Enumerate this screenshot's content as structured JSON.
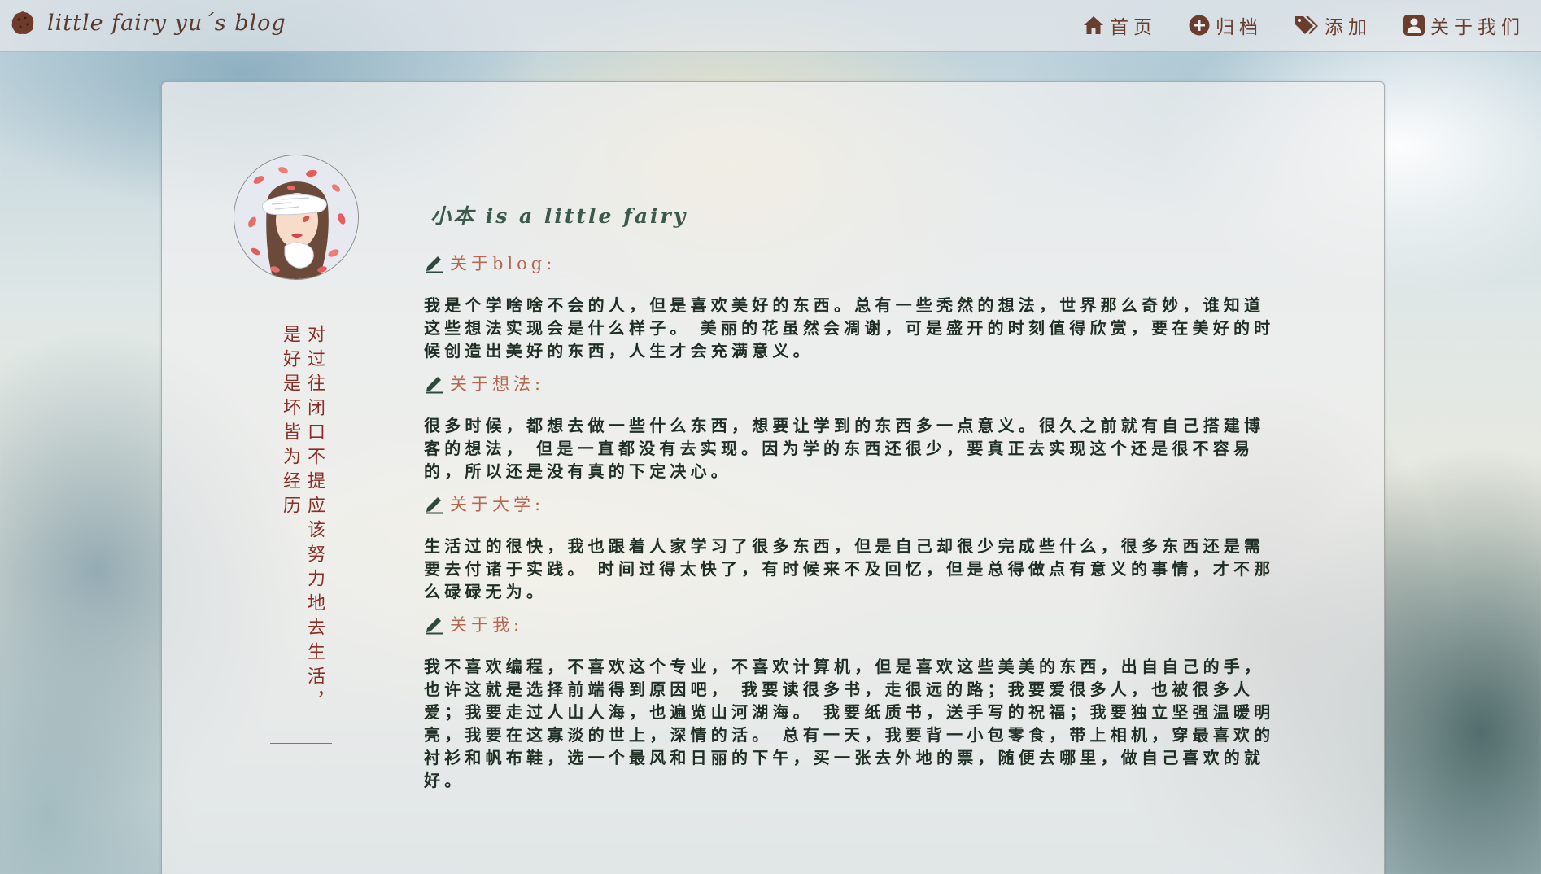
{
  "header": {
    "title": "little fairy yu´s blog",
    "nav": [
      {
        "label": "首页",
        "icon": "home-icon"
      },
      {
        "label": "归档",
        "icon": "plus-circle-icon"
      },
      {
        "label": "添加",
        "icon": "tags-icon"
      },
      {
        "label": "关于我们",
        "icon": "user-box-icon"
      }
    ]
  },
  "sidebar": {
    "motto": "对过往闭口不提应该努力地去生活，是好是坏皆为经历"
  },
  "main": {
    "title": "小本 is a little fairy",
    "sections": [
      {
        "heading": "关于blog:",
        "body": "我是个学啥啥不会的人，但是喜欢美好的东西。总有一些秃然的想法，世界那么奇妙，谁知道这些想法实现会是什么样子。 美丽的花虽然会凋谢，可是盛开的时刻值得欣赏，要在美好的时候创造出美好的东西，人生才会充满意义。"
      },
      {
        "heading": "关于想法:",
        "body": "很多时候，都想去做一些什么东西，想要让学到的东西多一点意义。很久之前就有自己搭建博客的想法， 但是一直都没有去实现。因为学的东西还很少，要真正去实现这个还是很不容易的，所以还是没有真的下定决心。"
      },
      {
        "heading": "关于大学:",
        "body": "生活过的很快，我也跟着人家学习了很多东西，但是自己却很少完成些什么，很多东西还是需要去付诸于实践。 时间过得太快了，有时候来不及回忆，但是总得做点有意义的事情，才不那么碌碌无为。"
      },
      {
        "heading": "关于我:",
        "body": "我不喜欢编程，不喜欢这个专业，不喜欢计算机，但是喜欢这些美美的东西，出自自己的手，也许这就是选择前端得到原因吧， 我要读很多书，走很远的路；我要爱很多人，也被很多人爱；我要走过人山人海，也遍览山河湖海。 我要纸质书，送手写的祝福；我要独立坚强温暖明亮，我要在这寡淡的世上，深情的活。 总有一天，我要背一小包零食，带上相机，穿最喜欢的衬衫和帆布鞋，选一个最风和日丽的下午，买一张去外地的票，随便去哪里，做自己喜欢的就好。"
      }
    ]
  },
  "colors": {
    "brand": "#5a3a2c",
    "nav": "#6a3e2f",
    "heading": "#b56850",
    "title": "#3b5a4c",
    "motto": "#8a2e25",
    "body": "#1f2f25"
  }
}
